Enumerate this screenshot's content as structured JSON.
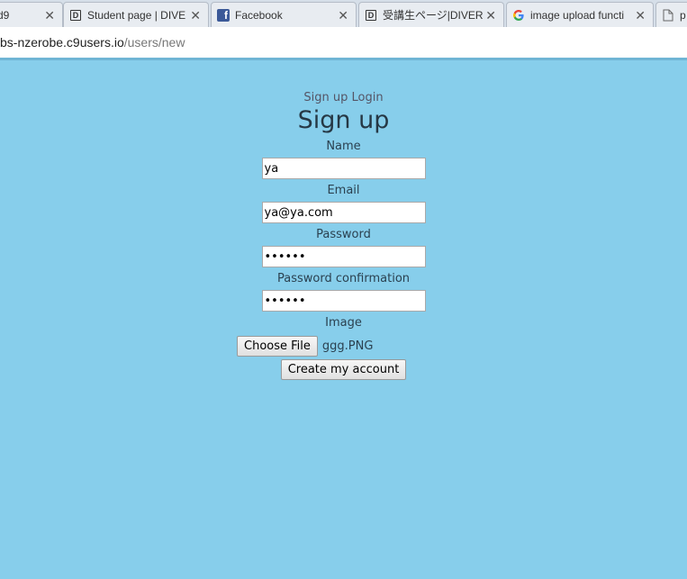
{
  "tabs": [
    {
      "title": "d9",
      "icon": "cloud9-icon"
    },
    {
      "title": "Student page | DIVE",
      "icon": "dive-d-icon"
    },
    {
      "title": "Facebook",
      "icon": "facebook-icon"
    },
    {
      "title": "受講生ページ|DIVER",
      "icon": "dive-d-icon"
    },
    {
      "title": "image upload functi",
      "icon": "google-icon"
    },
    {
      "title": "p",
      "icon": "page-icon"
    }
  ],
  "address": {
    "host": "bs-nzerobe.c9users.io",
    "path": "/users/new"
  },
  "nav": {
    "signup_link": "Sign up",
    "login_link": "Login"
  },
  "form": {
    "heading": "Sign up",
    "name_label": "Name",
    "name_value": "ya",
    "email_label": "Email",
    "email_value": "ya@ya.com",
    "password_label": "Password",
    "password_value": "••••••",
    "password_confirmation_label": "Password confirmation",
    "password_confirmation_value": "••••••",
    "image_label": "Image",
    "choose_file_label": "Choose File",
    "file_name": "ggg.PNG",
    "submit_label": "Create my account"
  },
  "colors": {
    "page_background": "#87ceeb",
    "facebook_blue": "#3b5998"
  }
}
